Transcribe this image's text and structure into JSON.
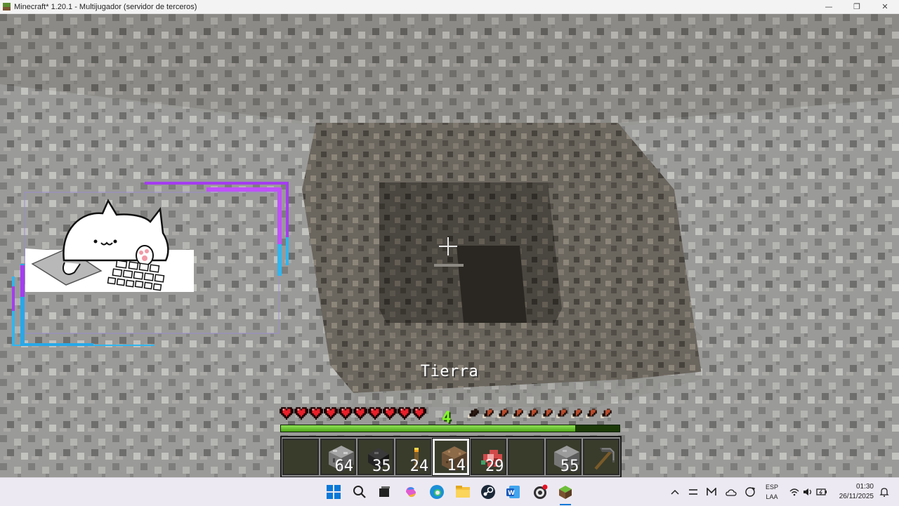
{
  "window": {
    "title": "Minecraft* 1.20.1 - Multijugador (servidor de terceros)",
    "minimize_icon": "minimize-icon",
    "maximize_icon": "restore-icon",
    "close_icon": "close-icon"
  },
  "hud": {
    "held_item_name": "Tierra",
    "level": "4",
    "hearts_full": 10,
    "food_full": 9,
    "food_half": 0,
    "food_empty": 1,
    "xp_progress": 0.87
  },
  "hotbar": {
    "selected_index": 4,
    "slots": [
      {
        "item": "empty",
        "count": ""
      },
      {
        "item": "cobblestone",
        "count": "64"
      },
      {
        "item": "coal",
        "count": "35"
      },
      {
        "item": "torch",
        "count": "24"
      },
      {
        "item": "dirt",
        "count": "14"
      },
      {
        "item": "raw-meat",
        "count": "29"
      },
      {
        "item": "empty",
        "count": ""
      },
      {
        "item": "stone",
        "count": "55"
      },
      {
        "item": "stone-pickaxe",
        "count": ""
      }
    ]
  },
  "taskbar": {
    "apps": [
      "windows-start-icon",
      "search-icon",
      "task-view-icon",
      "copilot-icon",
      "edge-icon",
      "file-explorer-icon",
      "steam-icon",
      "word-icon",
      "obs-icon",
      "minecraft-icon"
    ],
    "language_line1": "ESP",
    "language_line2": "LAA",
    "time": "01:30",
    "date": "26/11/2025"
  },
  "colors": {
    "heart": "#e8202a",
    "xp": "#7ffc20",
    "overlay_purple": "#a43cf0",
    "overlay_blue": "#2fb6f0"
  }
}
